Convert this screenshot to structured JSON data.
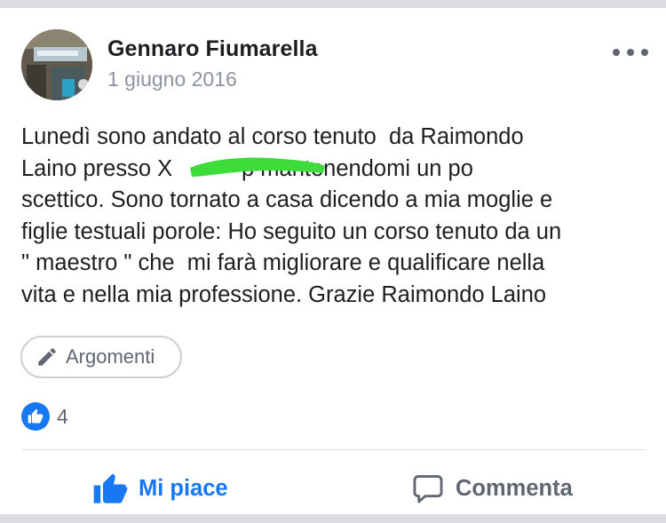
{
  "post": {
    "author": "Gennaro Fiumarella",
    "date": "1 giugno 2016",
    "text": "Lunedì sono andato al corso tenuto  da Raimondo\nLaino presso X           p mantenendomi un po\nscettico. Sono tornato a casa dicendo a mia moglie e\nfiglie testuali porole: Ho seguito un corso tenuto da un\n\" maestro \" che  mi farà migliorare e qualificare nella\nvita e nella mia professione. Grazie Raimondo Laino",
    "topic_label": "Argomenti",
    "reaction_count": "4"
  },
  "actions": {
    "like_label": "Mi piace",
    "comment_label": "Commenta"
  },
  "icons": {
    "more": "more-horizontal-icon",
    "pencil": "pencil-icon",
    "like_badge": "like-reaction-icon",
    "like": "thumbs-up-icon",
    "comment": "comment-bubble-icon"
  },
  "colors": {
    "accent_blue": "#1877f2",
    "redaction_green": "#3ddc3a",
    "secondary_text": "#606770"
  }
}
